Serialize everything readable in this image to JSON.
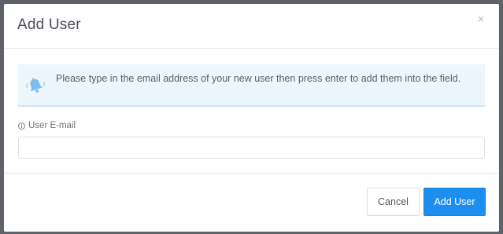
{
  "modal": {
    "title": "Add User",
    "close_symbol": "×"
  },
  "alert": {
    "icon": "bell-icon",
    "message": "Please type in the email address of your new user then press enter to add them into the field."
  },
  "field": {
    "icon": "info-icon",
    "label": "User E-mail",
    "value": "",
    "placeholder": ""
  },
  "footer": {
    "cancel_label": "Cancel",
    "submit_label": "Add User"
  },
  "colors": {
    "primary": "#1c8ef0",
    "alert_background": "#eef6fd",
    "alert_icon": "#7fbdee",
    "backdrop": "#5f6268"
  }
}
